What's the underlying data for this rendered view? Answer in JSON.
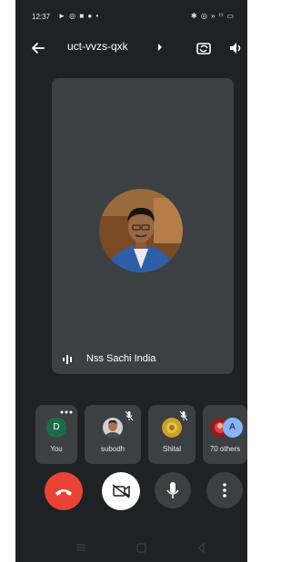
{
  "status_bar": {
    "time": "12:37",
    "left_icons": "► ◎ ■ ● •",
    "right_icons": "✱ ◎ » ᵗᵗ ▭"
  },
  "top_bar": {
    "meeting_code": "uct-vvzs-qxk"
  },
  "main_tile": {
    "participant_name": "Nss Sachi India"
  },
  "participants_strip": [
    {
      "label": "You",
      "initial": "D",
      "avatar_color": "#1e6b4a"
    },
    {
      "label": "subodh"
    },
    {
      "label": "Shital"
    },
    {
      "label": "70 others",
      "initial": "A",
      "avatar_color": "#8ab4f8"
    }
  ],
  "colors": {
    "background": "#202124",
    "tile": "#3c4043",
    "end_call": "#ea4335",
    "camera_off_button": "#ffffff",
    "controls": "#3c4043"
  },
  "icons": {
    "back": "arrow-left-icon",
    "camera_switch": "camera-switch-icon",
    "speaker": "speaker-icon",
    "end_call": "phone-hangup-icon",
    "camera": "video-off-icon",
    "mic": "mic-icon",
    "more": "more-vertical-icon"
  }
}
